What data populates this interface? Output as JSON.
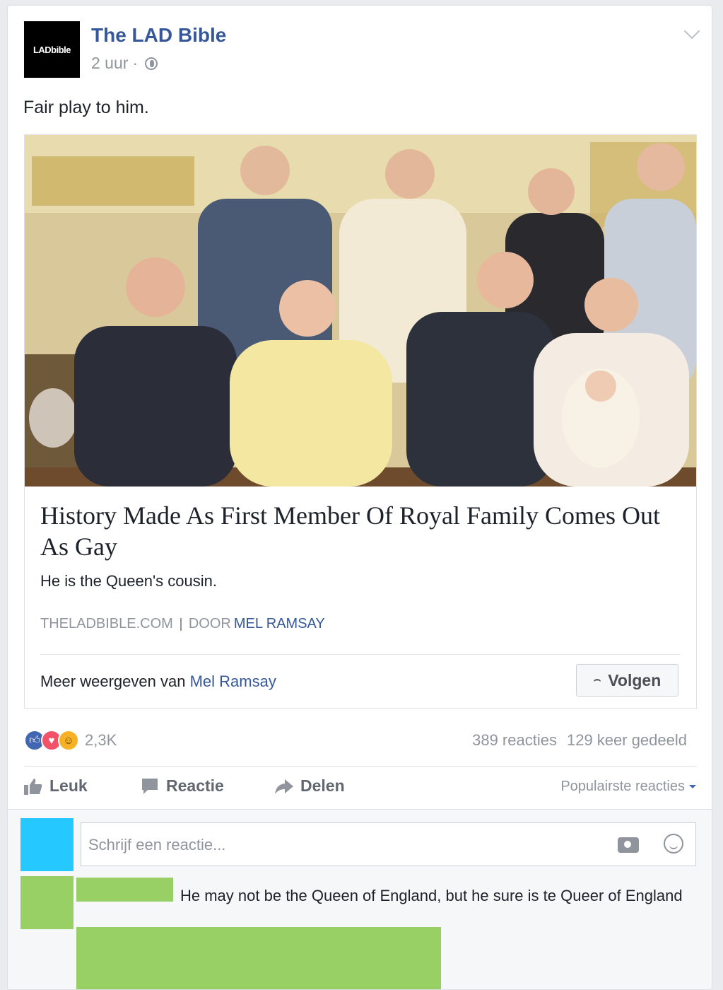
{
  "post": {
    "page_name": "The LAD Bible",
    "avatar_text": "LADbible",
    "time": "2 uur",
    "separator": "·",
    "text": "Fair play to him."
  },
  "link": {
    "title": "History Made As First Member Of Royal Family Comes Out As Gay",
    "description": "He is the Queen's cousin.",
    "domain": "THELADBIBLE.COM",
    "by": "DOOR",
    "author": "MEL RAMSAY",
    "more_from_label": "Meer weergeven van",
    "more_from_name": "Mel Ramsay",
    "follow_label": "Volgen"
  },
  "engagement": {
    "reaction_count": "2,3K",
    "comments": "389 reacties",
    "shares": "129 keer gedeeld"
  },
  "actions": {
    "like": "Leuk",
    "comment": "Reactie",
    "share": "Delen",
    "sort": "Populairste reacties"
  },
  "comments": {
    "placeholder": "Schrijf een reactie...",
    "first_comment": "He may not be the Queen of England, but he sure is te Queer of England"
  },
  "colors": {
    "link_blue": "#365899",
    "redaction_green": "#99d066",
    "avatar_cyan": "#25c8ff"
  }
}
